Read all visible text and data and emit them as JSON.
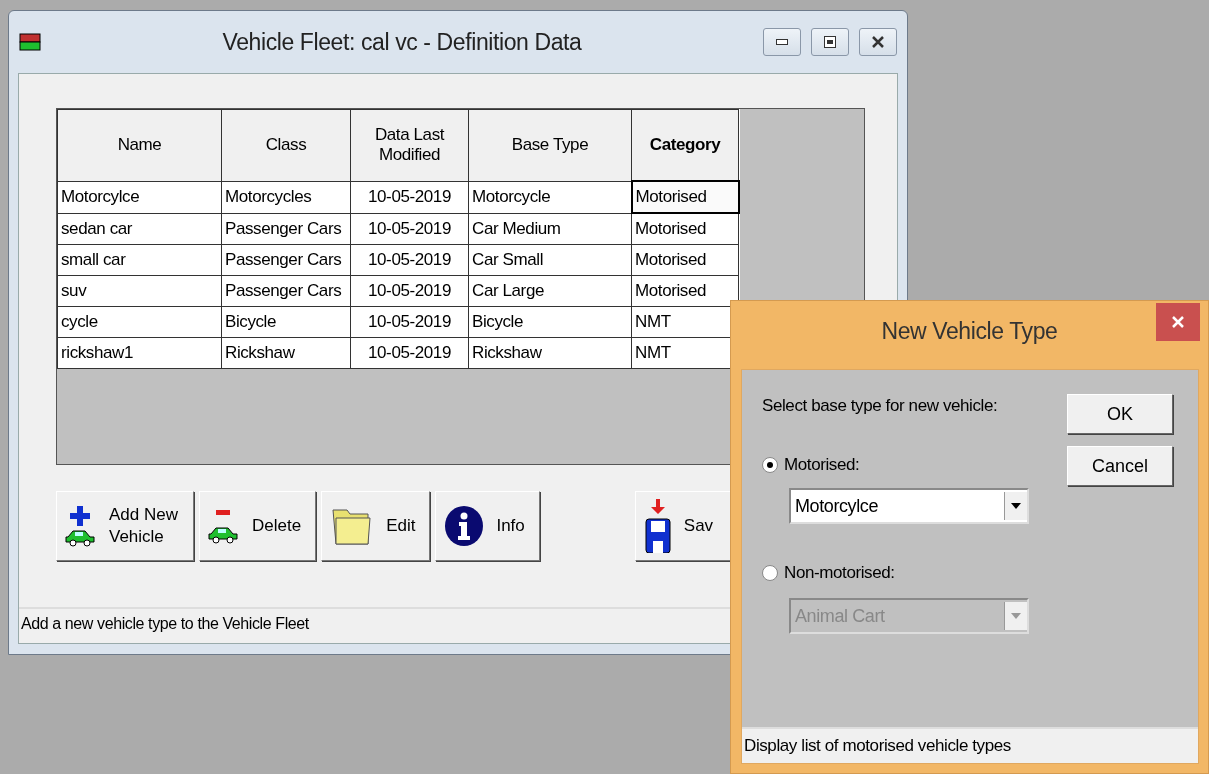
{
  "main_window": {
    "title": "Vehicle Fleet: cal vc - Definition Data",
    "table": {
      "columns": [
        {
          "label": "Name",
          "sorted": false
        },
        {
          "label": "Class",
          "sorted": false
        },
        {
          "label": "Data Last Modified",
          "sorted": false
        },
        {
          "label": "Base Type",
          "sorted": false
        },
        {
          "label": "Category",
          "sorted": true
        }
      ],
      "rows": [
        {
          "cells": [
            {
              "text": "Motorcylce",
              "focused": false
            },
            {
              "text": "Motorcycles",
              "focused": false
            },
            {
              "text": "10-05-2019",
              "focused": false
            },
            {
              "text": "Motorcycle",
              "focused": false
            },
            {
              "text": "Motorised",
              "focused": true
            }
          ]
        },
        {
          "cells": [
            {
              "text": "sedan car",
              "focused": false
            },
            {
              "text": "Passenger Cars",
              "focused": false
            },
            {
              "text": "10-05-2019",
              "focused": false
            },
            {
              "text": "Car Medium",
              "focused": false
            },
            {
              "text": "Motorised",
              "focused": false
            }
          ]
        },
        {
          "cells": [
            {
              "text": "small car",
              "focused": false
            },
            {
              "text": "Passenger Cars",
              "focused": false
            },
            {
              "text": "10-05-2019",
              "focused": false
            },
            {
              "text": "Car Small",
              "focused": false
            },
            {
              "text": "Motorised",
              "focused": false
            }
          ]
        },
        {
          "cells": [
            {
              "text": "suv",
              "focused": false
            },
            {
              "text": "Passenger Cars",
              "focused": false
            },
            {
              "text": "10-05-2019",
              "focused": false
            },
            {
              "text": "Car Large",
              "focused": false
            },
            {
              "text": "Motorised",
              "focused": false
            }
          ]
        },
        {
          "cells": [
            {
              "text": "cycle",
              "focused": false
            },
            {
              "text": "Bicycle",
              "focused": false
            },
            {
              "text": "10-05-2019",
              "focused": false
            },
            {
              "text": "Bicycle",
              "focused": false
            },
            {
              "text": "NMT",
              "focused": false
            }
          ]
        },
        {
          "cells": [
            {
              "text": "rickshaw1",
              "focused": false
            },
            {
              "text": "Rickshaw",
              "focused": false
            },
            {
              "text": "10-05-2019",
              "focused": false
            },
            {
              "text": "Rickshaw",
              "focused": false
            },
            {
              "text": "NMT",
              "focused": false
            }
          ]
        }
      ]
    },
    "buttons": [
      {
        "kind": "add",
        "label": "Add New Vehicle"
      },
      {
        "kind": "delete",
        "label": "Delete"
      },
      {
        "kind": "edit",
        "label": "Edit"
      },
      {
        "kind": "info",
        "label": "Info"
      },
      {
        "kind": "save",
        "label": "Sav"
      }
    ],
    "status_bar": "Add a new vehicle type to the Vehicle Fleet"
  },
  "dialog": {
    "title": "New Vehicle Type",
    "prompt": "Select base type for new vehicle:",
    "options": [
      {
        "label": "Motorised:",
        "selected": true,
        "dropdown": {
          "value": "Motorcylce",
          "disabled": false
        }
      },
      {
        "label": "Non-motorised:",
        "selected": false,
        "dropdown": {
          "value": "Animal Cart",
          "disabled": true
        }
      }
    ],
    "buttons": [
      "OK",
      "Cancel"
    ],
    "status_bar": "Display list of motorised vehicle types"
  }
}
